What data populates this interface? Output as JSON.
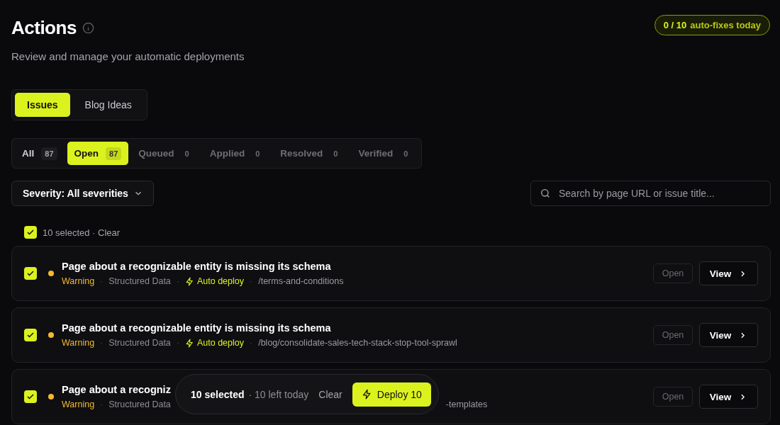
{
  "header": {
    "title": "Actions",
    "subtitle": "Review and manage your automatic deployments",
    "quota": {
      "count": "0 / 10",
      "label": "auto-fixes today"
    }
  },
  "tabs": [
    {
      "label": "Issues",
      "selected": true
    },
    {
      "label": "Blog Ideas",
      "selected": false
    }
  ],
  "filters": [
    {
      "label": "All",
      "count": "87",
      "selected": false,
      "dim": false
    },
    {
      "label": "Open",
      "count": "87",
      "selected": true,
      "dim": false
    },
    {
      "label": "Queued",
      "count": "0",
      "selected": false,
      "dim": true
    },
    {
      "label": "Applied",
      "count": "0",
      "selected": false,
      "dim": true
    },
    {
      "label": "Resolved",
      "count": "0",
      "selected": false,
      "dim": true
    },
    {
      "label": "Verified",
      "count": "0",
      "selected": false,
      "dim": true
    }
  ],
  "severity": {
    "label": "Severity: All severities"
  },
  "search": {
    "placeholder": "Search by page URL or issue title..."
  },
  "selection": {
    "checked": true,
    "label": "10 selected · Clear"
  },
  "issues": [
    {
      "checked": true,
      "color": "#f5b82e",
      "title": "Page about a recognizable entity is missing its schema",
      "covered": false,
      "open": {
        "label": "Open",
        "disabled": true
      },
      "view": "View",
      "meta": [
        {
          "kind": "severity",
          "text": "Warning"
        },
        {
          "kind": "separator",
          "text": "·"
        },
        {
          "kind": "category",
          "text": "Structured Data"
        },
        {
          "kind": "separator",
          "text": "·"
        },
        {
          "kind": "deploy",
          "text": "Auto deploy"
        },
        {
          "kind": "separator",
          "text": "·"
        },
        {
          "kind": "path",
          "text": "/terms-and-conditions"
        }
      ]
    },
    {
      "checked": true,
      "color": "#f5b82e",
      "title": "Page about a recognizable entity is missing its schema",
      "covered": false,
      "open": {
        "label": "Open",
        "disabled": true
      },
      "view": "View",
      "meta": [
        {
          "kind": "severity",
          "text": "Warning"
        },
        {
          "kind": "separator",
          "text": "·"
        },
        {
          "kind": "category",
          "text": "Structured Data"
        },
        {
          "kind": "separator",
          "text": "·"
        },
        {
          "kind": "deploy",
          "text": "Auto deploy"
        },
        {
          "kind": "separator",
          "text": "·"
        },
        {
          "kind": "path",
          "text": "/blog/consolidate-sales-tech-stack-stop-tool-sprawl"
        }
      ]
    },
    {
      "checked": true,
      "color": "#f5b82e",
      "title": "Page about a recogniz",
      "covered": true,
      "open": {
        "label": "Open",
        "disabled": true
      },
      "view": "View",
      "meta": [
        {
          "kind": "severity",
          "text": "Warning"
        },
        {
          "kind": "separator",
          "text": "·"
        },
        {
          "kind": "category",
          "text": "Structured Data"
        },
        {
          "kind": "path",
          "text": "-templates"
        }
      ]
    }
  ],
  "action_bar": {
    "selected": "10 selected",
    "left": "· 10 left today",
    "clear": "Clear",
    "deploy": "Deploy 10"
  }
}
